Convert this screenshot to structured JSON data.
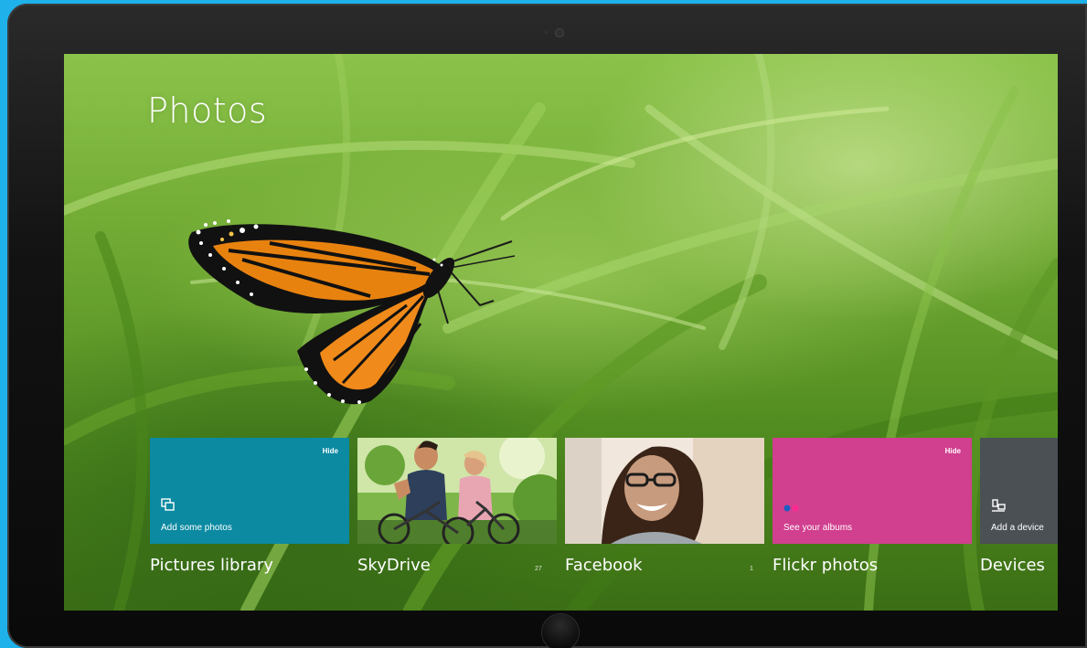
{
  "app": {
    "title": "Photos"
  },
  "tiles": [
    {
      "id": "pictures-library",
      "label": "Pictures library",
      "hide_label": "Hide",
      "caption": "Add some photos",
      "color": "#0b8aa1",
      "icon": "photos-stack-icon"
    },
    {
      "id": "skydrive",
      "label": "SkyDrive",
      "count": "27",
      "photo": "couple-bicycles-photo"
    },
    {
      "id": "facebook",
      "label": "Facebook",
      "count": "1",
      "photo": "smiling-woman-photo"
    },
    {
      "id": "flickr",
      "label": "Flickr photos",
      "hide_label": "Hide",
      "caption": "See your albums",
      "color": "#d13f8f",
      "icon": "flickr-dots-icon"
    },
    {
      "id": "devices",
      "label": "Devices",
      "caption": "Add a device",
      "color": "#4b5055",
      "icon": "device-icon"
    }
  ],
  "colors": {
    "bezel": "#111111",
    "backdrop": "#1fb1ea",
    "pictures_tile": "#0b8aa1",
    "flickr_tile": "#d13f8f",
    "devices_tile": "#4b5055"
  }
}
